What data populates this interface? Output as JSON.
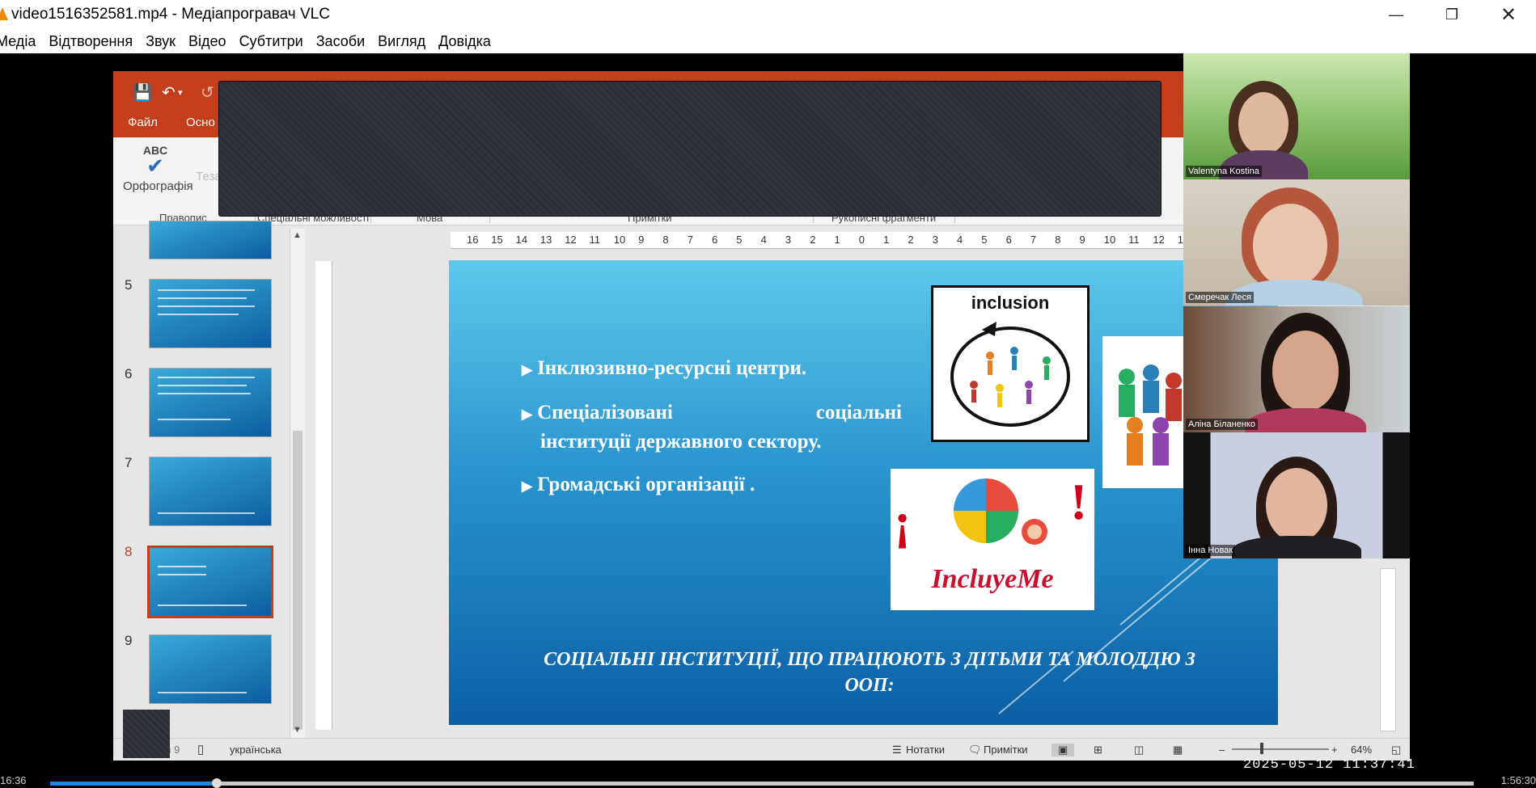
{
  "window": {
    "title": "video1516352581.mp4 - Медіапрогравач VLC",
    "icon": "vlc-cone-icon"
  },
  "menu": [
    "Медіа",
    "Відтворення",
    "Звук",
    "Відео",
    "Субтитри",
    "Засоби",
    "Вигляд",
    "Довідка"
  ],
  "ribbon": {
    "tabs": [
      "Файл",
      "Осно"
    ],
    "spell_check_label": "Орфографія",
    "spell_check_abc": "ABC",
    "thesaurus_label": "Теза",
    "groups": [
      "Правопис",
      "Спеціальні можливості",
      "Мова",
      "Примітки",
      "Рукописні фрагменти"
    ]
  },
  "thumbnails": {
    "numbers": [
      "5",
      "6",
      "7",
      "8",
      "9"
    ],
    "active": "8"
  },
  "slide": {
    "bullets": [
      "Інклюзивно-ресурсні центри.",
      "Спеціалізовані соціальні",
      "інституції державного сектору.",
      "Громадські організації ."
    ],
    "bullet_2_word1": "Спеціалізовані",
    "bullet_2_word2": "соціальні",
    "inclusion_label": "inclusion",
    "includeme_label": "IncluyeMe",
    "excl_left": "¡",
    "excl_right": "!",
    "bottom_title_line1": "СОЦІАЛЬНІ ІНСТИТУЦІЇ, ЩО ПРАЦЮЮТЬ З ДІТЬМИ ТА МОЛОДДЮ З",
    "bottom_title_line2": "ООП:"
  },
  "ruler_ticks": [
    "16",
    "15",
    "14",
    "13",
    "12",
    "11",
    "10",
    "9",
    "8",
    "7",
    "6",
    "5",
    "4",
    "3",
    "2",
    "1",
    "0",
    "1",
    "2",
    "3",
    "4",
    "5",
    "6",
    "7",
    "8",
    "9",
    "10",
    "11",
    "12",
    "1"
  ],
  "statusbar": {
    "slide_info": "Слайд 8 з 9",
    "language": "українська",
    "notes_label": "Нотатки",
    "comments_label": "Примітки",
    "zoom": "64%"
  },
  "participants": [
    {
      "name": "Valentyna Kostina"
    },
    {
      "name": "Смеречак Леся"
    },
    {
      "name": "Аліна Біланенко"
    },
    {
      "name": "Інна Новак"
    }
  ],
  "player": {
    "timestamp": "2025-05-12 11:37:41",
    "elapsed": "16:36",
    "total": "1:56:30",
    "progress": 0.117
  }
}
